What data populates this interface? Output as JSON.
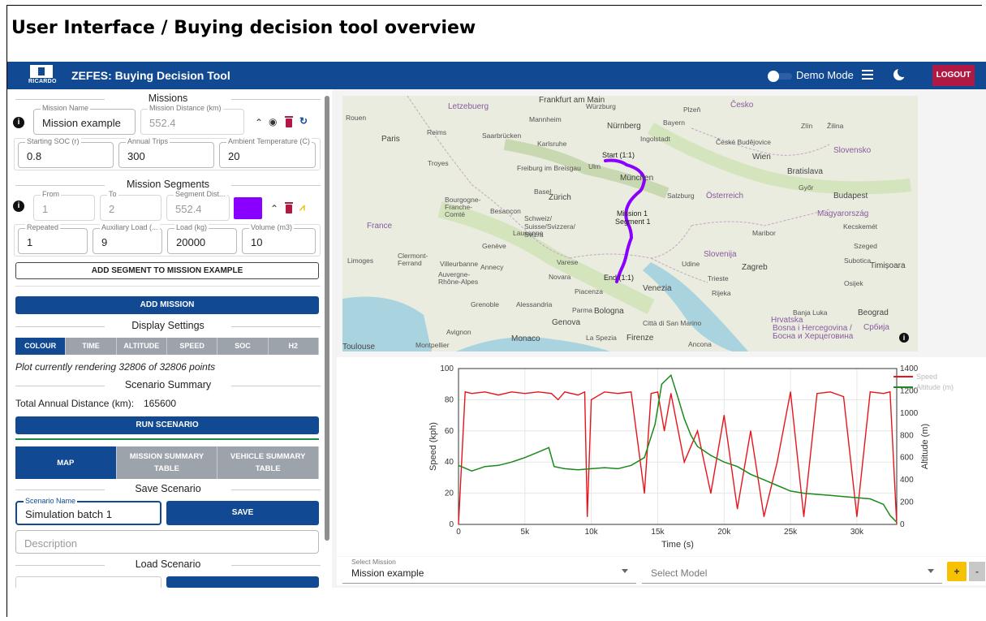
{
  "slide_title": "User Interface / Buying decision tool overview",
  "app": {
    "logo_text": "RICARDO",
    "title": "ZEFES: Buying Decision Tool",
    "demo_mode_label": "Demo Mode",
    "demo_mode_on": false,
    "logout_label": "LOGOUT",
    "brand_color": "#114a92",
    "logout_color": "#b01943"
  },
  "missions": {
    "heading": "Missions",
    "name_label": "Mission Name",
    "name_value": "Mission example",
    "distance_label": "Mission Distance (km)",
    "distance_value": "552.4",
    "soc_label": "Starting SOC (r)",
    "soc_value": "0.8",
    "trips_label": "Annual Trips",
    "trips_value": "300",
    "temp_label": "Ambient Temperature (C)",
    "temp_value": "20"
  },
  "segments": {
    "heading": "Mission Segments",
    "from_label": "From",
    "from_value": "1",
    "to_label": "To",
    "to_value": "2",
    "dist_label": "Segment Dist...",
    "dist_value": "552.4",
    "color": "#8a00ff",
    "repeated_label": "Repeated",
    "repeated_value": "1",
    "aux_label": "Auxiliary Load (...",
    "aux_value": "9",
    "load_label": "Load (kg)",
    "load_value": "20000",
    "volume_label": "Volume (m3)",
    "volume_value": "10",
    "add_segment_label": "ADD SEGMENT TO MISSION EXAMPLE"
  },
  "add_mission_label": "ADD MISSION",
  "display": {
    "heading": "Display Settings",
    "options": [
      "COLOUR",
      "TIME",
      "ALTITUDE",
      "SPEED",
      "SOC",
      "H2"
    ],
    "selected": "COLOUR",
    "render_note": "Plot currently rendering 32806 of 32806 points"
  },
  "summary": {
    "heading": "Scenario Summary",
    "label": "Total Annual Distance (km):",
    "value": "165600",
    "run_label": "RUN SCENARIO"
  },
  "view_tabs": [
    {
      "label": "MAP",
      "selected": true
    },
    {
      "label": "MISSION SUMMARY TABLE",
      "selected": false
    },
    {
      "label": "VEHICLE SUMMARY TABLE",
      "selected": false
    }
  ],
  "save": {
    "heading": "Save Scenario",
    "name_label": "Scenario Name",
    "name_value": "Simulation batch 1",
    "save_label": "SAVE",
    "description_placeholder": "Description"
  },
  "load": {
    "heading": "Load Scenario"
  },
  "map": {
    "route_color": "#8a00ff",
    "route_labels": [
      "Start (1:1)",
      "Mission 1",
      "Segment 1",
      "End (1:1)"
    ],
    "places": [
      "Frankfurt am Main",
      "Würzburg",
      "Plzeň",
      "Česko",
      "Rouen",
      "Letzebuerg",
      "Mannheim",
      "Nürnberg",
      "Reims",
      "Saarbrücken",
      "Ingolstadt",
      "Paris",
      "Karlsruhe",
      "Bayern",
      "České Budějovice",
      "Zlín",
      "Žilina",
      "Slovensko",
      "Troyes",
      "Freiburg im Breisgau",
      "Ulm",
      "München",
      "Wien",
      "Bratislava",
      "Basel",
      "Zürich",
      "Salzburg",
      "Österreich",
      "Győr",
      "Budapest",
      "Bourgogne-Franche-Comté",
      "Besançon",
      "Schweiz/ Suisse/Svizzera/ Svizra",
      "Magyarország",
      "Kecskemét",
      "France",
      "Lausanne",
      "Maribor",
      "Genève",
      "Slovenija",
      "Zagreb",
      "Szeged",
      "Limoges",
      "Clermont-Ferrand",
      "Villeurbanne",
      "Annecy",
      "Varese",
      "Udine",
      "Subotica",
      "Timișoara",
      "Auvergne-Rhône-Alpes",
      "Novara",
      "Trieste",
      "Osijek",
      "Grenoble",
      "Piacenza",
      "Venezia",
      "Rijeka",
      "Alessandria",
      "Parma",
      "Bologna",
      "Banja Luka",
      "Beograd",
      "Genova",
      "Città di San Marino",
      "Hrvatska",
      "Bosna i Hercegovina / Босна и Херцеговина",
      "Србија",
      "Avignon",
      "Monaco",
      "Montpellier",
      "La Spezia",
      "Firenze",
      "Ancona",
      "Toulouse"
    ]
  },
  "chart_data": {
    "type": "line",
    "xlabel": "Time (s)",
    "ylabel": "Speed (kph)",
    "y2label": "Altitude (m)",
    "xlim": [
      0,
      33000
    ],
    "ylim": [
      0,
      100
    ],
    "y2lim": [
      0,
      1400
    ],
    "x_ticks": [
      "0",
      "5k",
      "10k",
      "15k",
      "20k",
      "25k",
      "30k"
    ],
    "y_ticks": [
      "0",
      "20",
      "40",
      "60",
      "80",
      "100"
    ],
    "y2_ticks": [
      "0",
      "200",
      "400",
      "600",
      "800",
      "1000",
      "1200",
      "1400"
    ],
    "legend_position": "top-right",
    "series": [
      {
        "name": "Speed",
        "axis": "left",
        "color": "#e8141b",
        "x": [
          0,
          500,
          1000,
          2000,
          3000,
          4000,
          5000,
          6000,
          7000,
          7500,
          8000,
          9000,
          9500,
          9700,
          10000,
          11000,
          12000,
          13000,
          14000,
          14500,
          15000,
          15500,
          16000,
          17000,
          18000,
          19000,
          20000,
          21000,
          22000,
          23000,
          24000,
          25000,
          26000,
          27000,
          28000,
          29000,
          30000,
          31000,
          32000,
          32500,
          33000
        ],
        "values": [
          0,
          85,
          84,
          85,
          83,
          85,
          84,
          85,
          84,
          80,
          85,
          83,
          85,
          5,
          80,
          85,
          84,
          85,
          20,
          84,
          85,
          60,
          84,
          40,
          60,
          20,
          70,
          10,
          60,
          5,
          40,
          85,
          5,
          84,
          85,
          82,
          5,
          85,
          84,
          85,
          0
        ]
      },
      {
        "name": "Altitude (m)",
        "axis": "right",
        "color": "#1a8a1a",
        "x": [
          0,
          1000,
          2000,
          3000,
          4000,
          5000,
          6000,
          6800,
          7200,
          8000,
          9000,
          10000,
          11000,
          12000,
          13000,
          14000,
          14800,
          15300,
          16000,
          16500,
          17000,
          17500,
          18000,
          19000,
          20000,
          21000,
          22000,
          23000,
          24000,
          25000,
          26000,
          27000,
          28000,
          29000,
          30000,
          31000,
          32000,
          32500,
          33000
        ],
        "values": [
          530,
          480,
          520,
          530,
          560,
          600,
          650,
          690,
          520,
          500,
          490,
          500,
          510,
          500,
          530,
          600,
          900,
          1260,
          1340,
          1150,
          950,
          800,
          700,
          620,
          560,
          520,
          450,
          400,
          350,
          300,
          280,
          270,
          260,
          250,
          240,
          230,
          180,
          80,
          20
        ]
      }
    ]
  },
  "selectors": {
    "mission_label": "Select Mission",
    "mission_value": "Mission example",
    "model_placeholder": "Select Model",
    "plus_label": "+",
    "minus_label": "-"
  }
}
